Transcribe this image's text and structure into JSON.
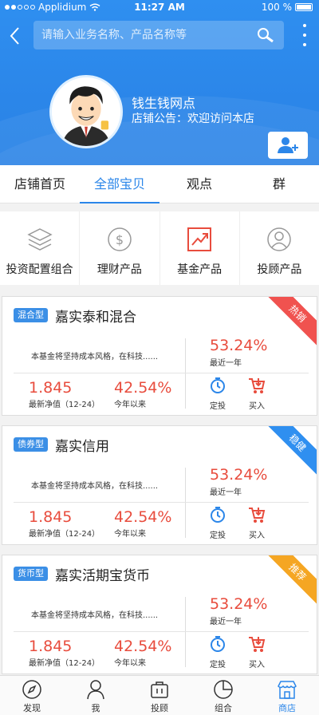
{
  "status": {
    "carrier": "Applidium",
    "time": "11:27 AM",
    "battery": "100 %"
  },
  "search": {
    "placeholder": "请输入业务名称、产品名称等"
  },
  "shop": {
    "name": "钱生钱网点",
    "notice": "店铺公告：欢迎访问本店"
  },
  "tabs": [
    {
      "label": "店铺首页",
      "active": false
    },
    {
      "label": "全部宝贝",
      "active": true
    },
    {
      "label": "观点",
      "active": false
    },
    {
      "label": "群",
      "active": false
    }
  ],
  "categories": [
    {
      "label": "投资配置组合",
      "icon": "layers-icon"
    },
    {
      "label": "理财产品",
      "icon": "dollar-coin-icon"
    },
    {
      "label": "基金产品",
      "icon": "trend-chart-icon"
    },
    {
      "label": "投顾产品",
      "icon": "person-icon"
    }
  ],
  "products": [
    {
      "type": "混合型",
      "name": "嘉实泰和混合",
      "badge": "热销",
      "badge_color": "#f0524f",
      "desc": "本基金将坚持成本风格，在科技......",
      "big_pct": "53.24%",
      "big_pct_label": "最近一年",
      "nav": "1.845",
      "nav_label": "最新净值（12-24）",
      "ytd": "42.54%",
      "ytd_label": "今年以来",
      "action1": "定投",
      "action2": "买入"
    },
    {
      "type": "债券型",
      "name": "嘉实信用",
      "badge": "稳健",
      "badge_color": "#2f8ff0",
      "desc": "本基金将坚持成本风格，在科技......",
      "big_pct": "53.24%",
      "big_pct_label": "最近一年",
      "nav": "1.845",
      "nav_label": "最新净值（12-24）",
      "ytd": "42.54%",
      "ytd_label": "今年以来",
      "action1": "定投",
      "action2": "买入"
    },
    {
      "type": "货币型",
      "name": "嘉实活期宝货币",
      "badge": "推荐",
      "badge_color": "#f5a623",
      "desc": "本基金将坚持成本风格，在科技......",
      "big_pct": "53.24%",
      "big_pct_label": "最近一年",
      "nav": "1.845",
      "nav_label": "最新净值（12-24）",
      "ytd": "42.54%",
      "ytd_label": "今年以来",
      "action1": "定投",
      "action2": "买入"
    }
  ],
  "bottom_nav": [
    {
      "label": "发现",
      "icon": "compass-icon",
      "active": false
    },
    {
      "label": "我",
      "icon": "user-icon",
      "active": false
    },
    {
      "label": "投顾",
      "icon": "briefcase-icon",
      "active": false
    },
    {
      "label": "组合",
      "icon": "pie-icon",
      "active": false
    },
    {
      "label": "商店",
      "icon": "store-icon",
      "active": true
    }
  ],
  "colors": {
    "primary": "#2b86e9",
    "accent_red": "#e84c3d"
  }
}
